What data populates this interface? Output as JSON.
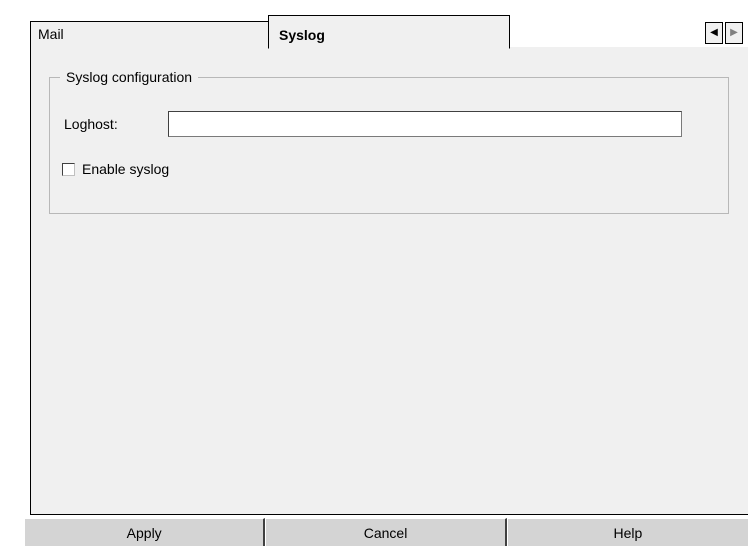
{
  "tabs": [
    {
      "label": "Mail"
    },
    {
      "label": "Syslog"
    }
  ],
  "scroll_arrows": {
    "left_icon": "triangle-left-icon",
    "right_icon": "triangle-right-icon",
    "left_glyph": "◀",
    "right_glyph": "▶"
  },
  "syslog": {
    "group_title": "Syslog configuration",
    "loghost_label": "Loghost:",
    "loghost_value": "",
    "enable_label": "Enable syslog",
    "enable_checked": false
  },
  "buttons": {
    "apply": "Apply",
    "cancel": "Cancel",
    "help": "Help"
  }
}
